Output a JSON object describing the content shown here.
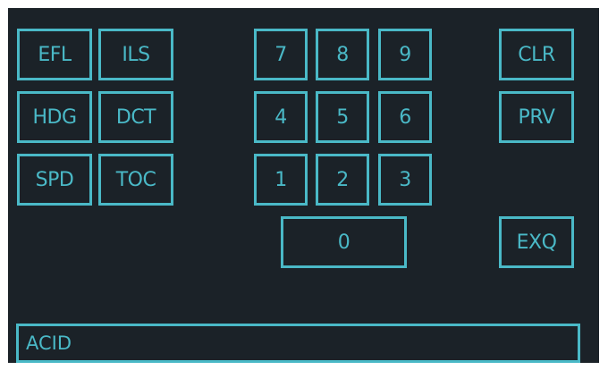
{
  "colors": {
    "background": "#1b2228",
    "accent": "#4ab9c7"
  },
  "function_keys": {
    "efl": "EFL",
    "ils": "ILS",
    "hdg": "HDG",
    "dct": "DCT",
    "spd": "SPD",
    "toc": "TOC"
  },
  "numpad": {
    "k7": "7",
    "k8": "8",
    "k9": "9",
    "k4": "4",
    "k5": "5",
    "k6": "6",
    "k1": "1",
    "k2": "2",
    "k3": "3",
    "k0": "0"
  },
  "control_keys": {
    "clr": "CLR",
    "prv": "PRV",
    "exq": "EXQ"
  },
  "acid_field": {
    "value": "ACID"
  }
}
